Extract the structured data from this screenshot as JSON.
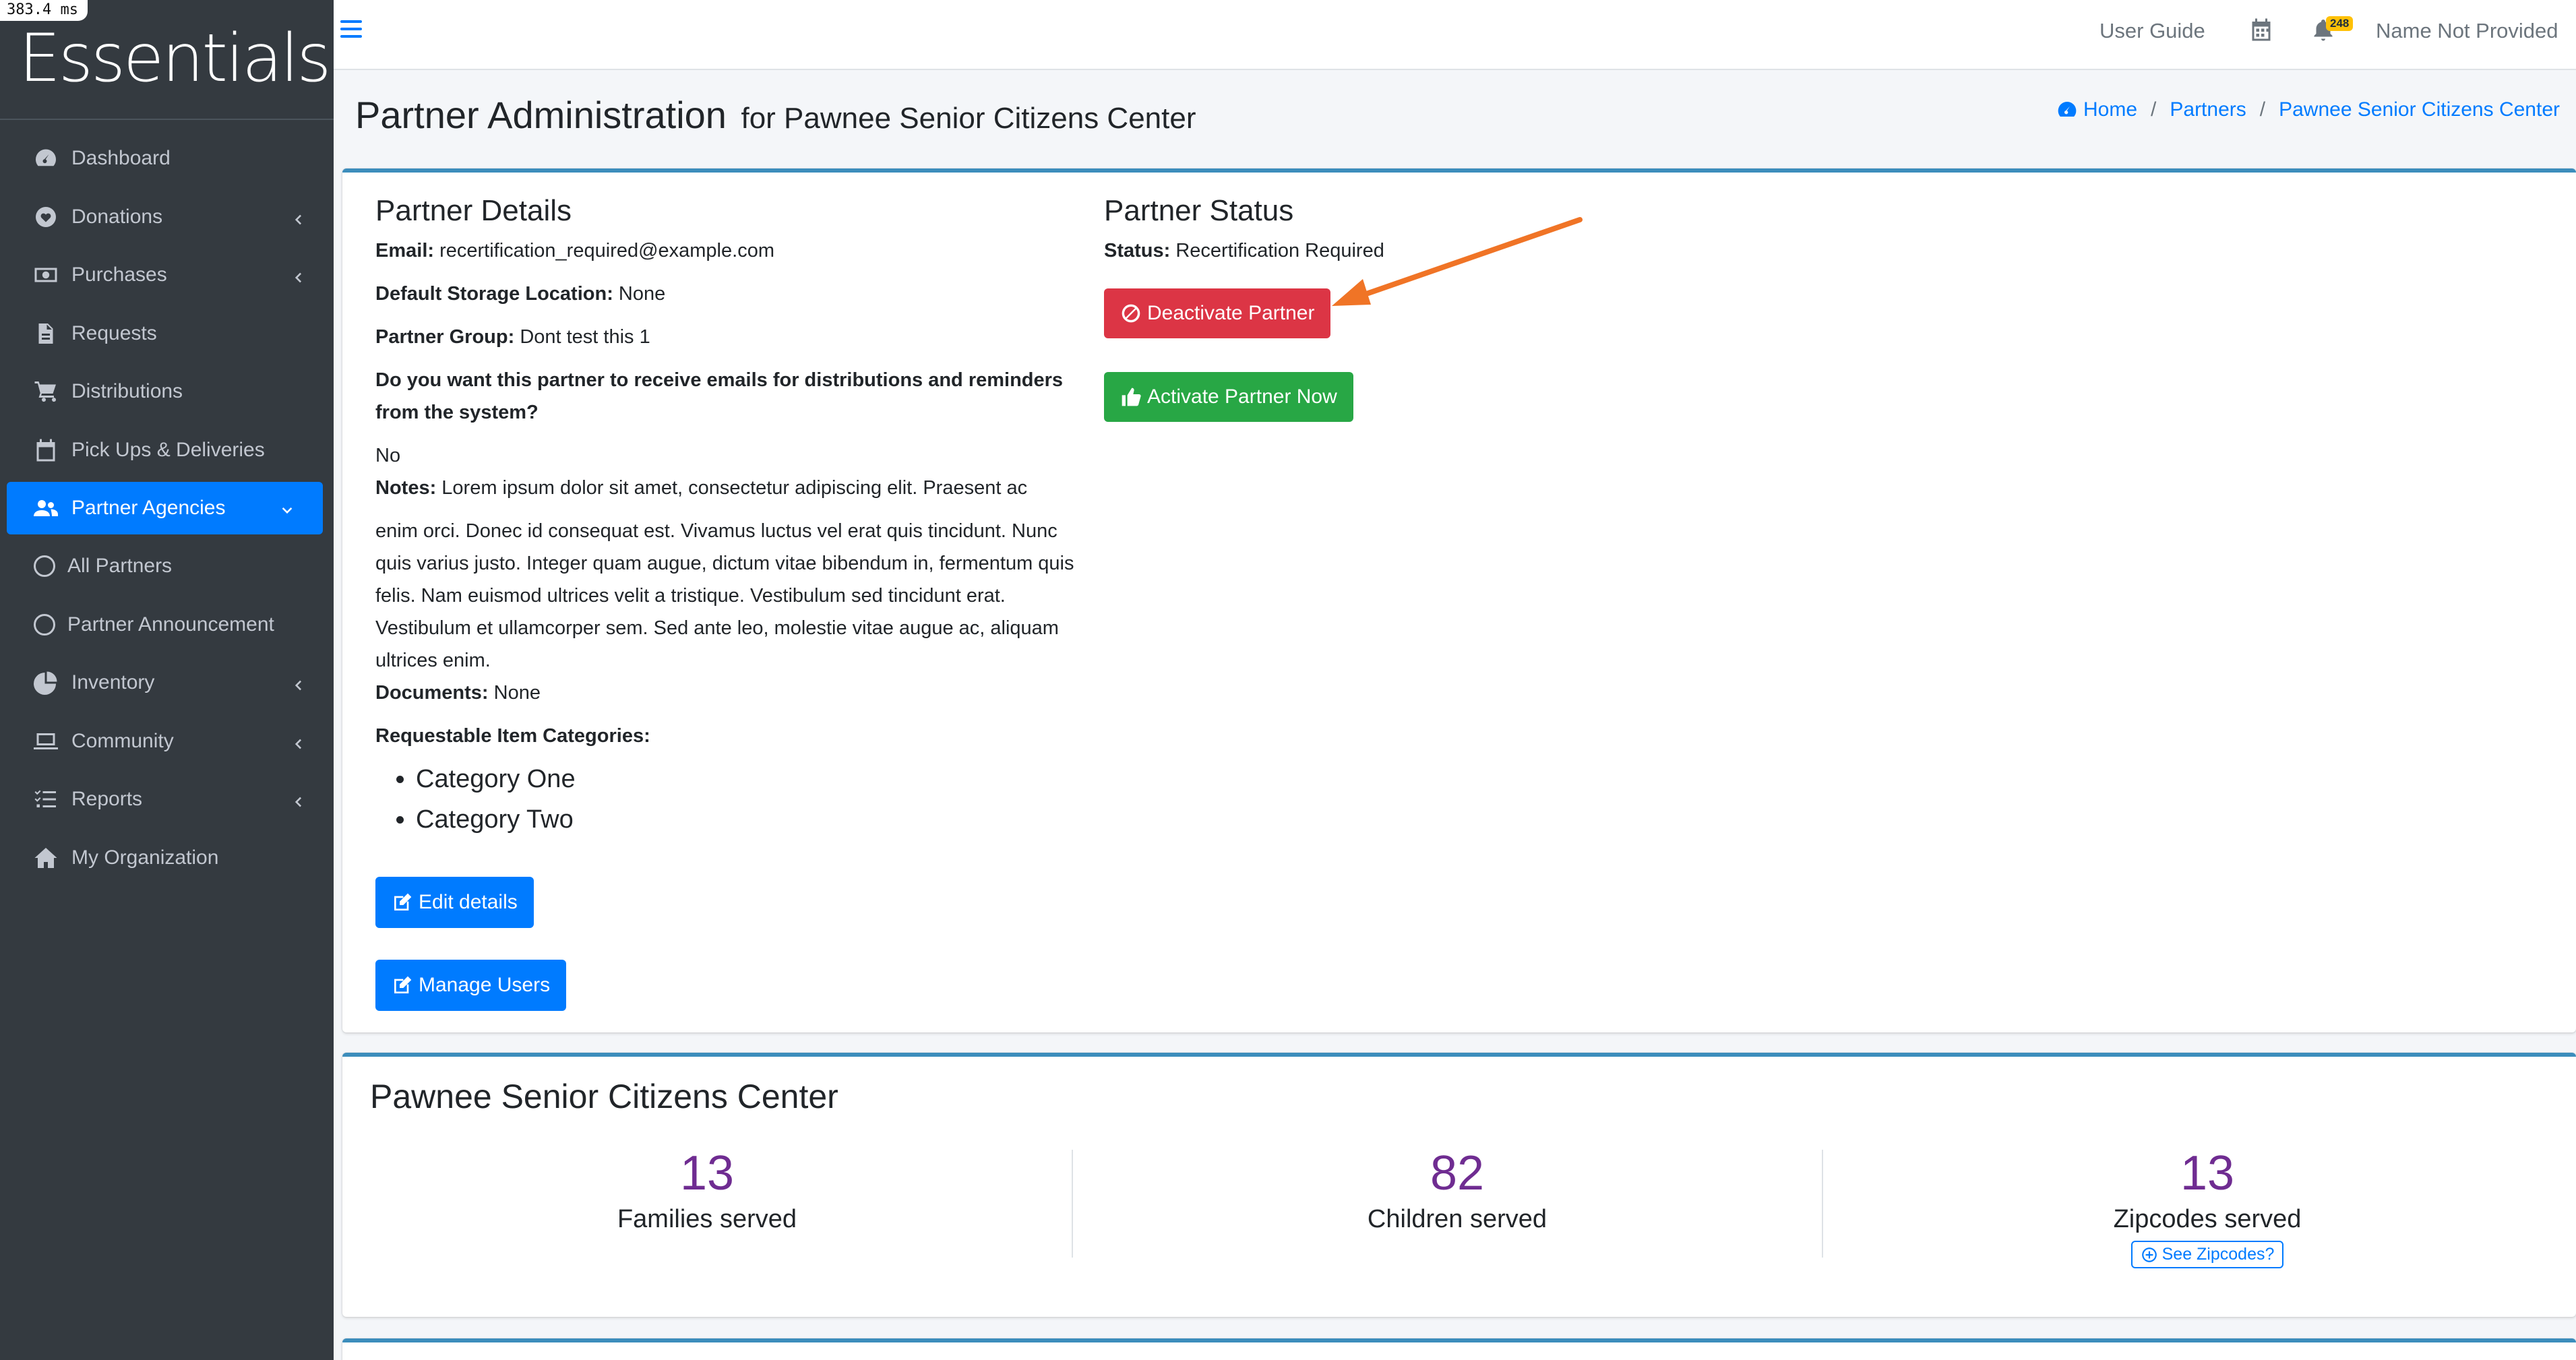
{
  "timer": "383.4 ms",
  "brand": "Essentials",
  "sidebar": {
    "items": [
      {
        "label": "Dashboard",
        "icon": "dashboard-icon"
      },
      {
        "label": "Donations",
        "icon": "heart-icon"
      },
      {
        "label": "Purchases",
        "icon": "money-icon"
      },
      {
        "label": "Requests",
        "icon": "file-icon"
      },
      {
        "label": "Distributions",
        "icon": "cart-icon"
      },
      {
        "label": "Pick Ups & Deliveries",
        "icon": "calendar-icon"
      },
      {
        "label": "Partner Agencies",
        "icon": "users-icon"
      },
      {
        "label": "All Partners",
        "icon": "circle-icon"
      },
      {
        "label": "Partner Announcement",
        "icon": "circle-icon"
      },
      {
        "label": "Inventory",
        "icon": "pie-chart-icon"
      },
      {
        "label": "Community",
        "icon": "laptop-icon"
      },
      {
        "label": "Reports",
        "icon": "list-icon"
      },
      {
        "label": "My Organization",
        "icon": "home-icon"
      }
    ]
  },
  "topbar": {
    "user_guide": "User Guide",
    "notification_count": "248",
    "user_name": "Name Not Provided"
  },
  "header": {
    "title": "Partner Administration",
    "subtitle": "for Pawnee Senior Citizens Center",
    "breadcrumb": [
      "Home",
      "Partners",
      "Pawnee Senior Citizens Center"
    ]
  },
  "details": {
    "heading": "Partner Details",
    "email_label": "Email:",
    "email": "recertification_required@example.com",
    "storage_label": "Default Storage Location:",
    "storage": "None",
    "group_label": "Partner Group:",
    "group": "Dont test this 1",
    "emails_question": "Do you want this partner to receive emails for distributions and reminders from the system?",
    "emails_answer": "No",
    "notes_label": "Notes:",
    "notes_first": "Lorem ipsum dolor sit amet, consectetur adipiscing elit. Praesent ac",
    "notes_rest": "enim orci. Donec id consequat est. Vivamus luctus vel erat quis tincidunt. Nunc quis varius justo. Integer quam augue, dictum vitae bibendum in, fermentum quis felis. Nam euismod ultrices velit a tristique. Vestibulum sed tincidunt erat. Vestibulum et ullamcorper sem. Sed ante leo, molestie vitae augue ac, aliquam ultrices enim.",
    "documents_label": "Documents:",
    "documents": "None",
    "categories_label": "Requestable Item Categories:",
    "categories": [
      "Category One",
      "Category Two"
    ],
    "edit_button": "Edit details",
    "manage_button": "Manage Users"
  },
  "status": {
    "heading": "Partner Status",
    "status_label": "Status:",
    "status_value": "Recertification Required",
    "deactivate_button": "Deactivate Partner",
    "activate_button": "Activate Partner Now"
  },
  "summary": {
    "heading": "Pawnee Senior Citizens Center",
    "stats": [
      {
        "value": "13",
        "label": "Families served"
      },
      {
        "value": "82",
        "label": "Children served"
      },
      {
        "value": "13",
        "label": "Zipcodes served"
      }
    ],
    "zip_button": "See Zipcodes?"
  },
  "colors": {
    "sidebar_bg": "#343a40",
    "primary": "#007bff",
    "danger": "#dc3545",
    "success": "#28a745",
    "stat_number": "#6f2c91",
    "annotation_arrow": "#f07426"
  }
}
